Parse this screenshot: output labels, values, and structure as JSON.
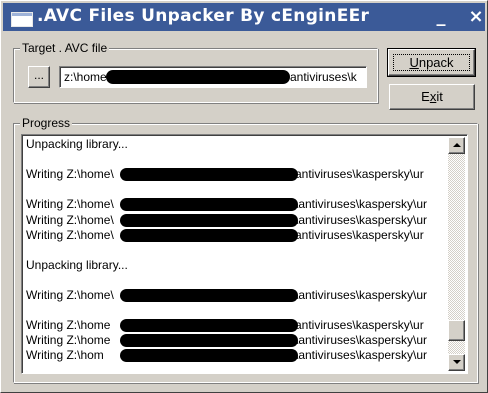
{
  "window": {
    "title": ".AVC Files Unpacker By cEnginEEr",
    "minimize_glyph": "_",
    "close_glyph": "×"
  },
  "target_group": {
    "label": "Target . AVC file",
    "browse_label": "...",
    "path_prefix": "z:\\home",
    "path_suffix": "antiviruses\\k"
  },
  "buttons": {
    "unpack_accel": "U",
    "unpack_rest": "npack",
    "exit_first": "E",
    "exit_accel": "x",
    "exit_rest": "it"
  },
  "progress_group": {
    "label": "Progress",
    "lines": [
      {
        "kind": "status",
        "text": "Unpacking library..."
      },
      {
        "kind": "blank",
        "text": ""
      },
      {
        "kind": "write",
        "prefix": "Writing Z:\\home\\",
        "suffix": "antiviruses\\kaspersky\\ur"
      },
      {
        "kind": "blank",
        "text": ""
      },
      {
        "kind": "write",
        "prefix": "Writing Z:\\home\\",
        "suffix": "\\antiviruses\\kaspersky\\ur"
      },
      {
        "kind": "write",
        "prefix": "Writing Z:\\home\\",
        "suffix": "\\antiviruses\\kaspersky\\ur"
      },
      {
        "kind": "write",
        "prefix": "Writing Z:\\home\\",
        "suffix": "antiviruses\\kaspersky\\ur"
      },
      {
        "kind": "blank",
        "text": ""
      },
      {
        "kind": "status",
        "text": "Unpacking library..."
      },
      {
        "kind": "blank",
        "text": ""
      },
      {
        "kind": "write",
        "prefix": "Writing Z:\\home\\",
        "suffix": "\\antiviruses\\kaspersky\\ur"
      },
      {
        "kind": "blank",
        "text": ""
      },
      {
        "kind": "write",
        "prefix": "Writing Z:\\home",
        "suffix": "antiviruses\\kaspersky\\ur"
      },
      {
        "kind": "write",
        "prefix": "Writing Z:\\home",
        "suffix": "\\antiviruses\\kaspersky\\ur"
      },
      {
        "kind": "write",
        "prefix": "Writing Z:\\hom",
        "suffix": "\\antiviruses\\kaspersky\\ur"
      }
    ]
  },
  "scrollbar": {
    "position": 0.93
  },
  "colors": {
    "titlebar": "#3b5a98",
    "face": "#d4d0c8",
    "redaction": "#000000"
  }
}
